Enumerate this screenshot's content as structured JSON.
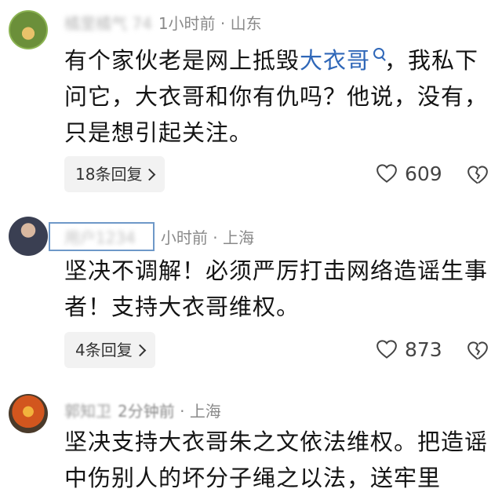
{
  "comments": [
    {
      "nickname": "橘里橘气 74",
      "time": "1小时前",
      "location": "山东",
      "text_before": "有个家伙老是网上抵毁",
      "link": "大衣哥",
      "text_after": "，我私下问它，大衣哥和你有仇吗？他说，没有，只是想引起关注。",
      "replies": "18条回复",
      "likes": "609"
    },
    {
      "nickname": "用户1234",
      "time": "小时前",
      "location": "上海",
      "text": "坚决不调解！必须严厉打击网络造谣生事者！支持大衣哥维权。",
      "replies": "4条回复",
      "likes": "873"
    },
    {
      "nickname": "郭知卫",
      "time": "2分钟前",
      "location": "上海",
      "text": "坚决支持大衣哥朱之文依法维权。把造谣中伤别人的坏分子绳之以法，送牢里"
    }
  ],
  "separator": "·"
}
